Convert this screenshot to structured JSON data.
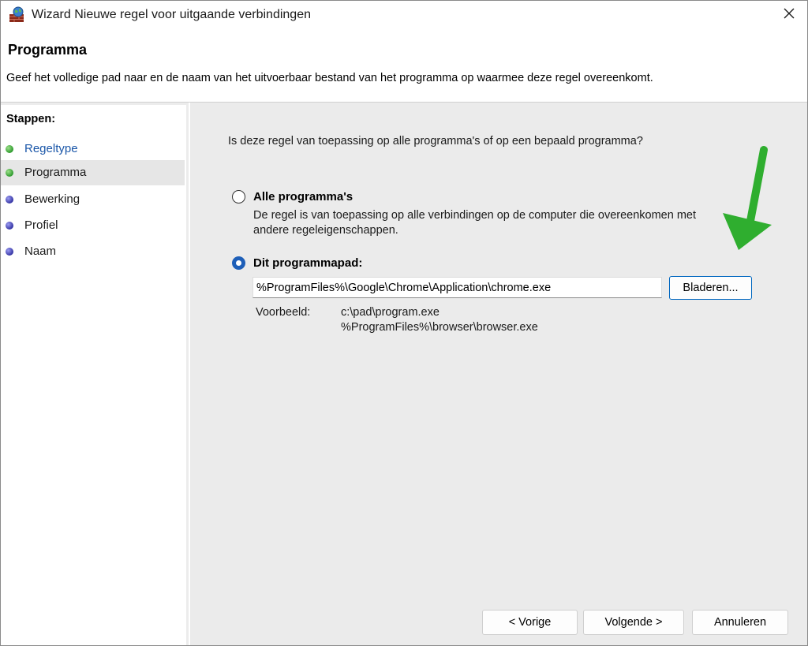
{
  "window": {
    "title": "Wizard Nieuwe regel voor uitgaande verbindingen",
    "close_glyph": "✕",
    "icon": "firewall-icon"
  },
  "header": {
    "title": "Programma",
    "description": "Geef het volledige pad naar en de naam van het uitvoerbaar bestand van het programma op waarmee deze regel overeenkomt."
  },
  "sidebar": {
    "title": "Stappen:",
    "steps": [
      {
        "label": "Regeltype",
        "status": "done",
        "color": "#2e9a2e"
      },
      {
        "label": "Programma",
        "status": "current",
        "color": "#2e9a2e"
      },
      {
        "label": "Bewerking",
        "status": "pending",
        "color": "#3434a4"
      },
      {
        "label": "Profiel",
        "status": "pending",
        "color": "#3434a4"
      },
      {
        "label": "Naam",
        "status": "pending",
        "color": "#3434a4"
      }
    ]
  },
  "main": {
    "question": "Is deze regel van toepassing op alle programma's of op een bepaald programma?",
    "option_all": {
      "label": "Alle programma's",
      "description": "De regel is van toepassing op alle verbindingen op de computer die overeenkomen met andere regeleigenschappen.",
      "selected": false
    },
    "option_path": {
      "label": "Dit programmapad:",
      "selected": true,
      "value": "%ProgramFiles%\\Google\\Chrome\\Application\\chrome.exe",
      "browse_label": "Bladeren..."
    },
    "example": {
      "label": "Voorbeeld:",
      "line1": "c:\\pad\\program.exe",
      "line2": "%ProgramFiles%\\browser\\browser.exe"
    },
    "annotation_arrow_color": "#2fae2f"
  },
  "footer": {
    "back_label": "< Vorige",
    "next_label": "Volgende >",
    "cancel_label": "Annuleren"
  },
  "colors": {
    "accent": "#1e5fb8",
    "link": "#1a56a8",
    "content_bg": "#ebebeb"
  }
}
